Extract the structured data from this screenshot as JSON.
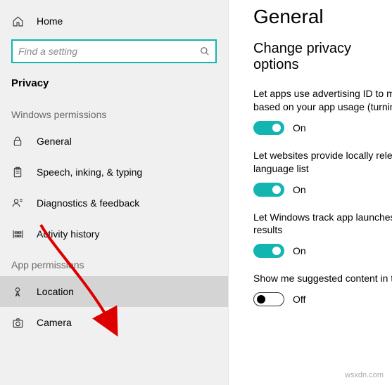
{
  "sidebar": {
    "home": "Home",
    "search_placeholder": "Find a setting",
    "section_title": "Privacy",
    "group1_title": "Windows permissions",
    "group2_title": "App permissions",
    "items": {
      "general": "General",
      "speech": "Speech, inking, & typing",
      "diagnostics": "Diagnostics & feedback",
      "activity": "Activity history",
      "location": "Location",
      "camera": "Camera"
    }
  },
  "main": {
    "title": "General",
    "subtitle": "Change privacy options",
    "settings": [
      {
        "desc": "Let apps use advertising ID to ma\nbased on your app usage (turning",
        "on": true,
        "label": "On"
      },
      {
        "desc": "Let websites provide locally releva\nlanguage list",
        "on": true,
        "label": "On"
      },
      {
        "desc": "Let Windows track app launches t\nresults",
        "on": true,
        "label": "On"
      },
      {
        "desc": "Show me suggested content in th",
        "on": false,
        "label": "Off"
      }
    ]
  },
  "watermark": "wsxdn.com"
}
